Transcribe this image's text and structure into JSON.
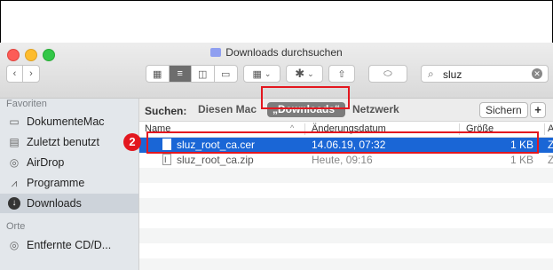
{
  "window": {
    "title": "Downloads durchsuchen"
  },
  "toolbar": {
    "back_icon": "‹",
    "forward_icon": "›",
    "search_value": "sluz"
  },
  "sidebar": {
    "favorites_header": "Favoriten",
    "locations_header": "Orte",
    "items": [
      {
        "label": "DokumenteMac",
        "icon": "folder-icon"
      },
      {
        "label": "Zuletzt benutzt",
        "icon": "recents-icon"
      },
      {
        "label": "AirDrop",
        "icon": "airdrop-icon"
      },
      {
        "label": "Programme",
        "icon": "applications-icon"
      },
      {
        "label": "Downloads",
        "icon": "downloads-icon"
      }
    ],
    "location_items": [
      {
        "label": "Entfernte CD/D...",
        "icon": "disc-icon"
      }
    ]
  },
  "scope": {
    "label": "Suchen:",
    "this_mac": "Diesen Mac",
    "downloads": "„Downloads“",
    "network": "Netzwerk",
    "save": "Sichern",
    "add": "+"
  },
  "columns": {
    "name": "Name",
    "date": "Änderungsdatum",
    "size": "Größe",
    "kind": "Ar"
  },
  "files": [
    {
      "name": "sluz_root_ca.cer",
      "date": "14.06.19, 07:32",
      "size": "1 KB",
      "kind": "Z"
    },
    {
      "name": "sluz_root_ca.zip",
      "date": "Heute, 09:16",
      "size": "1 KB",
      "kind": "Z"
    }
  ],
  "annotation": {
    "step": "2",
    "color": "#e3171f"
  },
  "colors": {
    "selection": "#1a66d6",
    "sidebar_bg": "#e3e7eb"
  }
}
